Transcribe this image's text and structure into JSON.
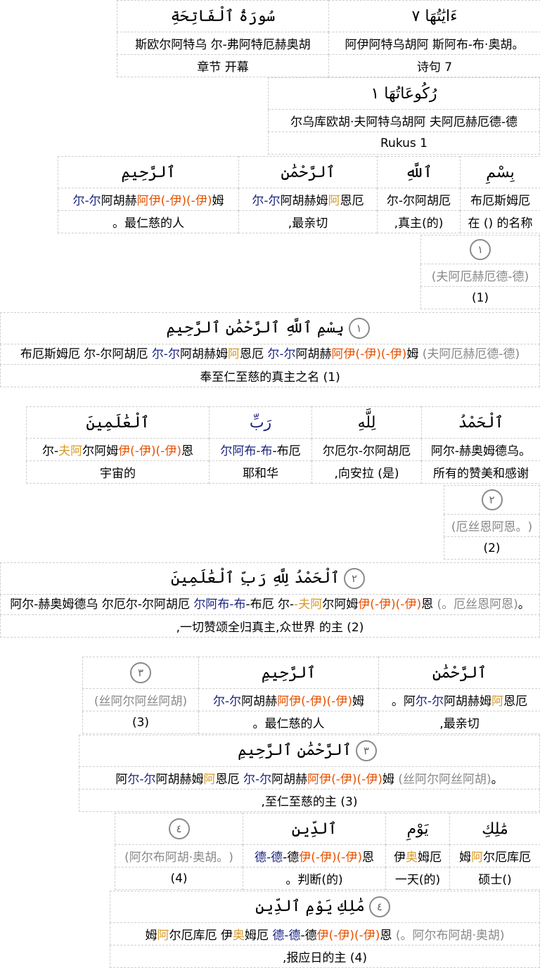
{
  "header": {
    "surah_ar": "سُورَةُ ٱلْفَاتِحَةِ",
    "surah_tr": "斯欧尔阿特乌 尔-弗阿特厄赫奥胡",
    "surah_tx": "章节 开幕",
    "ayahs_ar": "ءَايَٰتُهَا ٧",
    "ayahs_tr": "。阿伊阿特乌胡阿 斯阿布-布·奥胡",
    "ayahs_tx": "诗句 7",
    "rukus_ar": "رُكُوعَاتُهَا ١",
    "rukus_tr": "尔乌库欧胡·夫阿特乌胡阿 夫阿厄赫厄德-德",
    "rukus_tx": "Rukus 1"
  },
  "verse1": {
    "words": [
      {
        "ar": "بِسْمِ",
        "tr": "布厄斯姆厄",
        "tx": "在 () 的名称"
      },
      {
        "ar": "ٱللَّهِ",
        "tr": "尔-尔阿胡厄",
        "tx": "(的)真主,"
      },
      {
        "ar": "ٱلرَّحْمَٰنِ",
        "tr_a": "尔-尔",
        "tr_b": "阿胡赫姆",
        "tr_c": "阿",
        "tr_d": "恩厄",
        "tx": "最亲切,"
      },
      {
        "ar": "ٱلرَّحِيمِ",
        "tr_a": "尔-尔",
        "tr_b": "阿胡赫",
        "tr_c": "阿伊(-伊)(-伊)",
        "tr_d": "姆",
        "tx": "最仁慈的人。"
      }
    ],
    "end_num": "١",
    "end_tr": "(夫阿厄赫厄德-德)",
    "end_tx": "(1)",
    "full_ar": "بِسْمِ ٱللَّهِ ٱلرَّحْمَٰنِ ٱلرَّحِيمِ",
    "full_tr_1": "布厄斯姆厄 尔-尔阿胡厄 ",
    "full_tr_2": "尔-尔",
    "full_tr_3": "阿胡赫姆",
    "full_tr_4": "阿",
    "full_tr_5": "恩厄 ",
    "full_tr_6": "尔-尔",
    "full_tr_7": "阿胡赫",
    "full_tr_8": "阿伊(-伊)(-伊)",
    "full_tr_9": "姆 ",
    "full_tr_10": "(夫阿厄赫厄德-德)",
    "full_tx": "(1) 奉至仁至慈的真主之名"
  },
  "verse2": {
    "w1_ar": "ٱلْحَمْدُ",
    "w1_tr": "。阿尔-赫奥姆德乌",
    "w1_tx": "所有的赞美和感谢",
    "w2_ar": "لِلَّهِ",
    "w2_tr": "尔厄尔-尔阿胡厄",
    "w2_tx": "(是) 向安拉,",
    "w3_ar": "رَبِّ",
    "w3_tr_a": "尔阿",
    "w3_tr_b": "布-布",
    "w3_tr_c": "-布厄",
    "w3_tx": "耶和华",
    "w4_ar": "ٱلْعَٰلَمِينَ",
    "w4_tr_a": "尔-",
    "w4_tr_b": "夫阿",
    "w4_tr_c": "尔阿姆",
    "w4_tr_d": "伊(-伊)(-伊)",
    "w4_tr_e": "恩",
    "w4_tx": "宇宙的",
    "end_num": "٢",
    "end_tr": "(。厄丝恩阿恩)",
    "end_tx": "(2)",
    "full_ar": "ٱلْحَمْدُ لِلَّهِ رَبِّ ٱلْعَٰلَمِينَ",
    "full_tr_1": "。阿尔-赫奥姆德乌 尔厄尔-尔阿胡厄 ",
    "full_tr_2": "尔阿",
    "full_tr_3": "布-布",
    "full_tr_4": "-布厄 尔-",
    "full_tr_5": "-夫阿",
    "full_tr_6": "尔阿姆",
    "full_tr_7": "伊(-伊)(-伊)",
    "full_tr_8": "恩 ",
    "full_tr_9": "(。厄丝恩阿恩)",
    "full_tx": "(2) 一切赞颂全归真主,众世界 的主,"
  },
  "verse3": {
    "w1_ar": "ٱلرَّحْمَٰنِ",
    "w1_tr_a": "。阿",
    "w1_tr_b": "尔-尔",
    "w1_tr_c": "阿胡赫姆",
    "w1_tr_d": "阿",
    "w1_tr_e": "恩厄",
    "w1_tx": "最亲切,",
    "w2_ar": "ٱلرَّحِيمِ",
    "w2_tr_a": "尔-尔",
    "w2_tr_b": "阿胡赫",
    "w2_tr_c": "阿伊(-伊)(-伊)",
    "w2_tr_d": "姆",
    "w2_tx": "最仁慈的人。",
    "end_num": "٣",
    "end_tr": "(丝阿尔阿丝阿胡)",
    "end_tx": "(3)",
    "full_ar": "ٱلرَّحْمَٰنِ ٱلرَّحِيمِ",
    "full_tr_1": "。阿",
    "full_tr_2": "尔-尔",
    "full_tr_3": "阿胡赫姆",
    "full_tr_4": "阿",
    "full_tr_5": "恩厄 ",
    "full_tr_6": "尔-尔",
    "full_tr_7": "阿胡赫",
    "full_tr_8": "阿伊(-伊)(-伊)",
    "full_tr_9": "姆 ",
    "full_tr_10": "(丝阿尔阿丝阿胡)",
    "full_tx": "(3) 至仁至慈的主,"
  },
  "verse4": {
    "w1_ar": "مَٰلِكِ",
    "w1_tr_a": "姆",
    "w1_tr_b": "阿",
    "w1_tr_c": "尔厄库厄",
    "w1_tx": "()硕士",
    "w2_ar": "يَوْمِ",
    "w2_tr_a": "伊",
    "w2_tr_b": "奥",
    "w2_tr_c": "姆厄",
    "w2_tx": "(的)一天",
    "w3_ar": "ٱلدِّينِ",
    "w3_tr_a": "德-德",
    "w3_tr_b": "-德",
    "w3_tr_c": "伊(-伊)(-伊)",
    "w3_tr_d": "恩",
    "w3_tx": "(的)判断。",
    "end_num": "٤",
    "end_tr": "(。阿尔布阿胡·奥胡)",
    "end_tx": "(4)",
    "full_ar": "مَٰلِكِ يَوْمِ ٱلدِّينِ",
    "full_tr_1": "姆",
    "full_tr_2": "阿",
    "full_tr_3": "尔厄库厄 伊",
    "full_tr_4": "奥",
    "full_tr_5": "姆厄 ",
    "full_tr_6": "德-德",
    "full_tr_7": "-德",
    "full_tr_8": "伊(-伊)(-伊)",
    "full_tr_9": "恩 ",
    "full_tr_10": "(。阿尔布阿胡·奥胡)",
    "full_tx": "(4) 报应日的主,"
  }
}
